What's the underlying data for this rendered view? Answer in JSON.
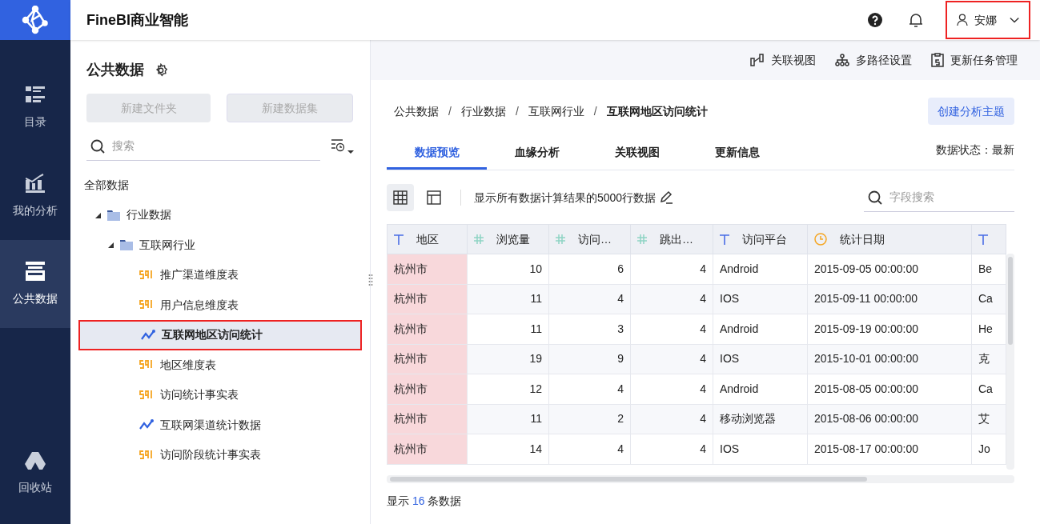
{
  "app": {
    "title": "FineBI商业智能",
    "user": "安娜"
  },
  "nav": [
    {
      "label": "目录",
      "selected": false
    },
    {
      "label": "我的分析",
      "selected": false
    },
    {
      "label": "公共数据",
      "selected": true
    },
    {
      "label": "回收站",
      "selected": false
    }
  ],
  "sidebar": {
    "title": "公共数据",
    "buttons": [
      "新建文件夹",
      "新建数据集"
    ],
    "search": {
      "placeholder": "搜索"
    },
    "root": "全部数据",
    "tree": [
      {
        "label": "行业数据",
        "kind": "folder",
        "expanded": true,
        "selected": false,
        "children": [
          {
            "label": "互联网行业",
            "kind": "folder",
            "expanded": true,
            "selected": false,
            "children": [
              {
                "label": "推广渠道维度表",
                "kind": "sql",
                "selected": false
              },
              {
                "label": "用户信息维度表",
                "kind": "sql",
                "selected": false
              },
              {
                "label": "互联网地区访问统计",
                "kind": "chart",
                "selected": true
              },
              {
                "label": "地区维度表",
                "kind": "sql",
                "selected": false
              },
              {
                "label": "访问统计事实表",
                "kind": "sql",
                "selected": false
              },
              {
                "label": "互联网渠道统计数据",
                "kind": "chart",
                "selected": false
              },
              {
                "label": "访问阶段统计事实表",
                "kind": "sql",
                "selected": false
              }
            ]
          }
        ]
      }
    ]
  },
  "toolbar": [
    {
      "label": "关联视图"
    },
    {
      "label": "多路径设置"
    },
    {
      "label": "更新任务管理"
    }
  ],
  "breadcrumb": [
    {
      "kind": "link",
      "label": "公共数据"
    },
    {
      "kind": "separator",
      "label": "/"
    },
    {
      "kind": "link",
      "label": "行业数据"
    },
    {
      "kind": "separator",
      "label": "/"
    },
    {
      "kind": "link",
      "label": "互联网行业"
    },
    {
      "kind": "separator",
      "label": "/"
    },
    {
      "kind": "current",
      "label": "互联网地区访问统计"
    }
  ],
  "create_button": "创建分析主题",
  "tabs": [
    {
      "label": "数据预览",
      "selected": true
    },
    {
      "label": "血缘分析",
      "selected": false
    },
    {
      "label": "关联视图",
      "selected": false
    },
    {
      "label": "更新信息",
      "selected": false
    }
  ],
  "data_status": "数据状态：最新",
  "view_modes": [
    {
      "selected": true
    },
    {
      "selected": false
    }
  ],
  "row_note": "显示所有数据计算结果的5000行数据",
  "field_search": {
    "placeholder": "字段搜索"
  },
  "table": {
    "columns": [
      {
        "label": "地区",
        "kind": "text",
        "highlighted": true
      },
      {
        "label": "浏览量",
        "kind": "number",
        "highlighted": false
      },
      {
        "label": "访问…",
        "kind": "number",
        "highlighted": false
      },
      {
        "label": "跳出…",
        "kind": "number",
        "highlighted": false
      },
      {
        "label": "访问平台",
        "kind": "text",
        "highlighted": false
      },
      {
        "label": "统计日期",
        "kind": "date",
        "highlighted": false
      },
      {
        "kind": "text",
        "highlighted": false
      }
    ],
    "rows": [
      [
        "杭州市",
        "10",
        "6",
        "4",
        "Android",
        "2015-09-05 00:00:00",
        "Be"
      ],
      [
        "杭州市",
        "11",
        "4",
        "4",
        "IOS",
        "2015-09-11 00:00:00",
        "Ca"
      ],
      [
        "杭州市",
        "11",
        "3",
        "4",
        "Android",
        "2015-09-19 00:00:00",
        "He"
      ],
      [
        "杭州市",
        "19",
        "9",
        "4",
        "IOS",
        "2015-10-01 00:00:00",
        "克"
      ],
      [
        "杭州市",
        "12",
        "4",
        "4",
        "Android",
        "2015-08-05 00:00:00",
        "Ca"
      ],
      [
        "杭州市",
        "11",
        "2",
        "4",
        "移动浏览器",
        "2015-08-06 00:00:00",
        "艾"
      ],
      [
        "杭州市",
        "14",
        "4",
        "4",
        "IOS",
        "2015-08-17 00:00:00",
        "Jo"
      ]
    ]
  },
  "footer": {
    "before": "显示",
    "count": "16",
    "after": "条数据"
  }
}
